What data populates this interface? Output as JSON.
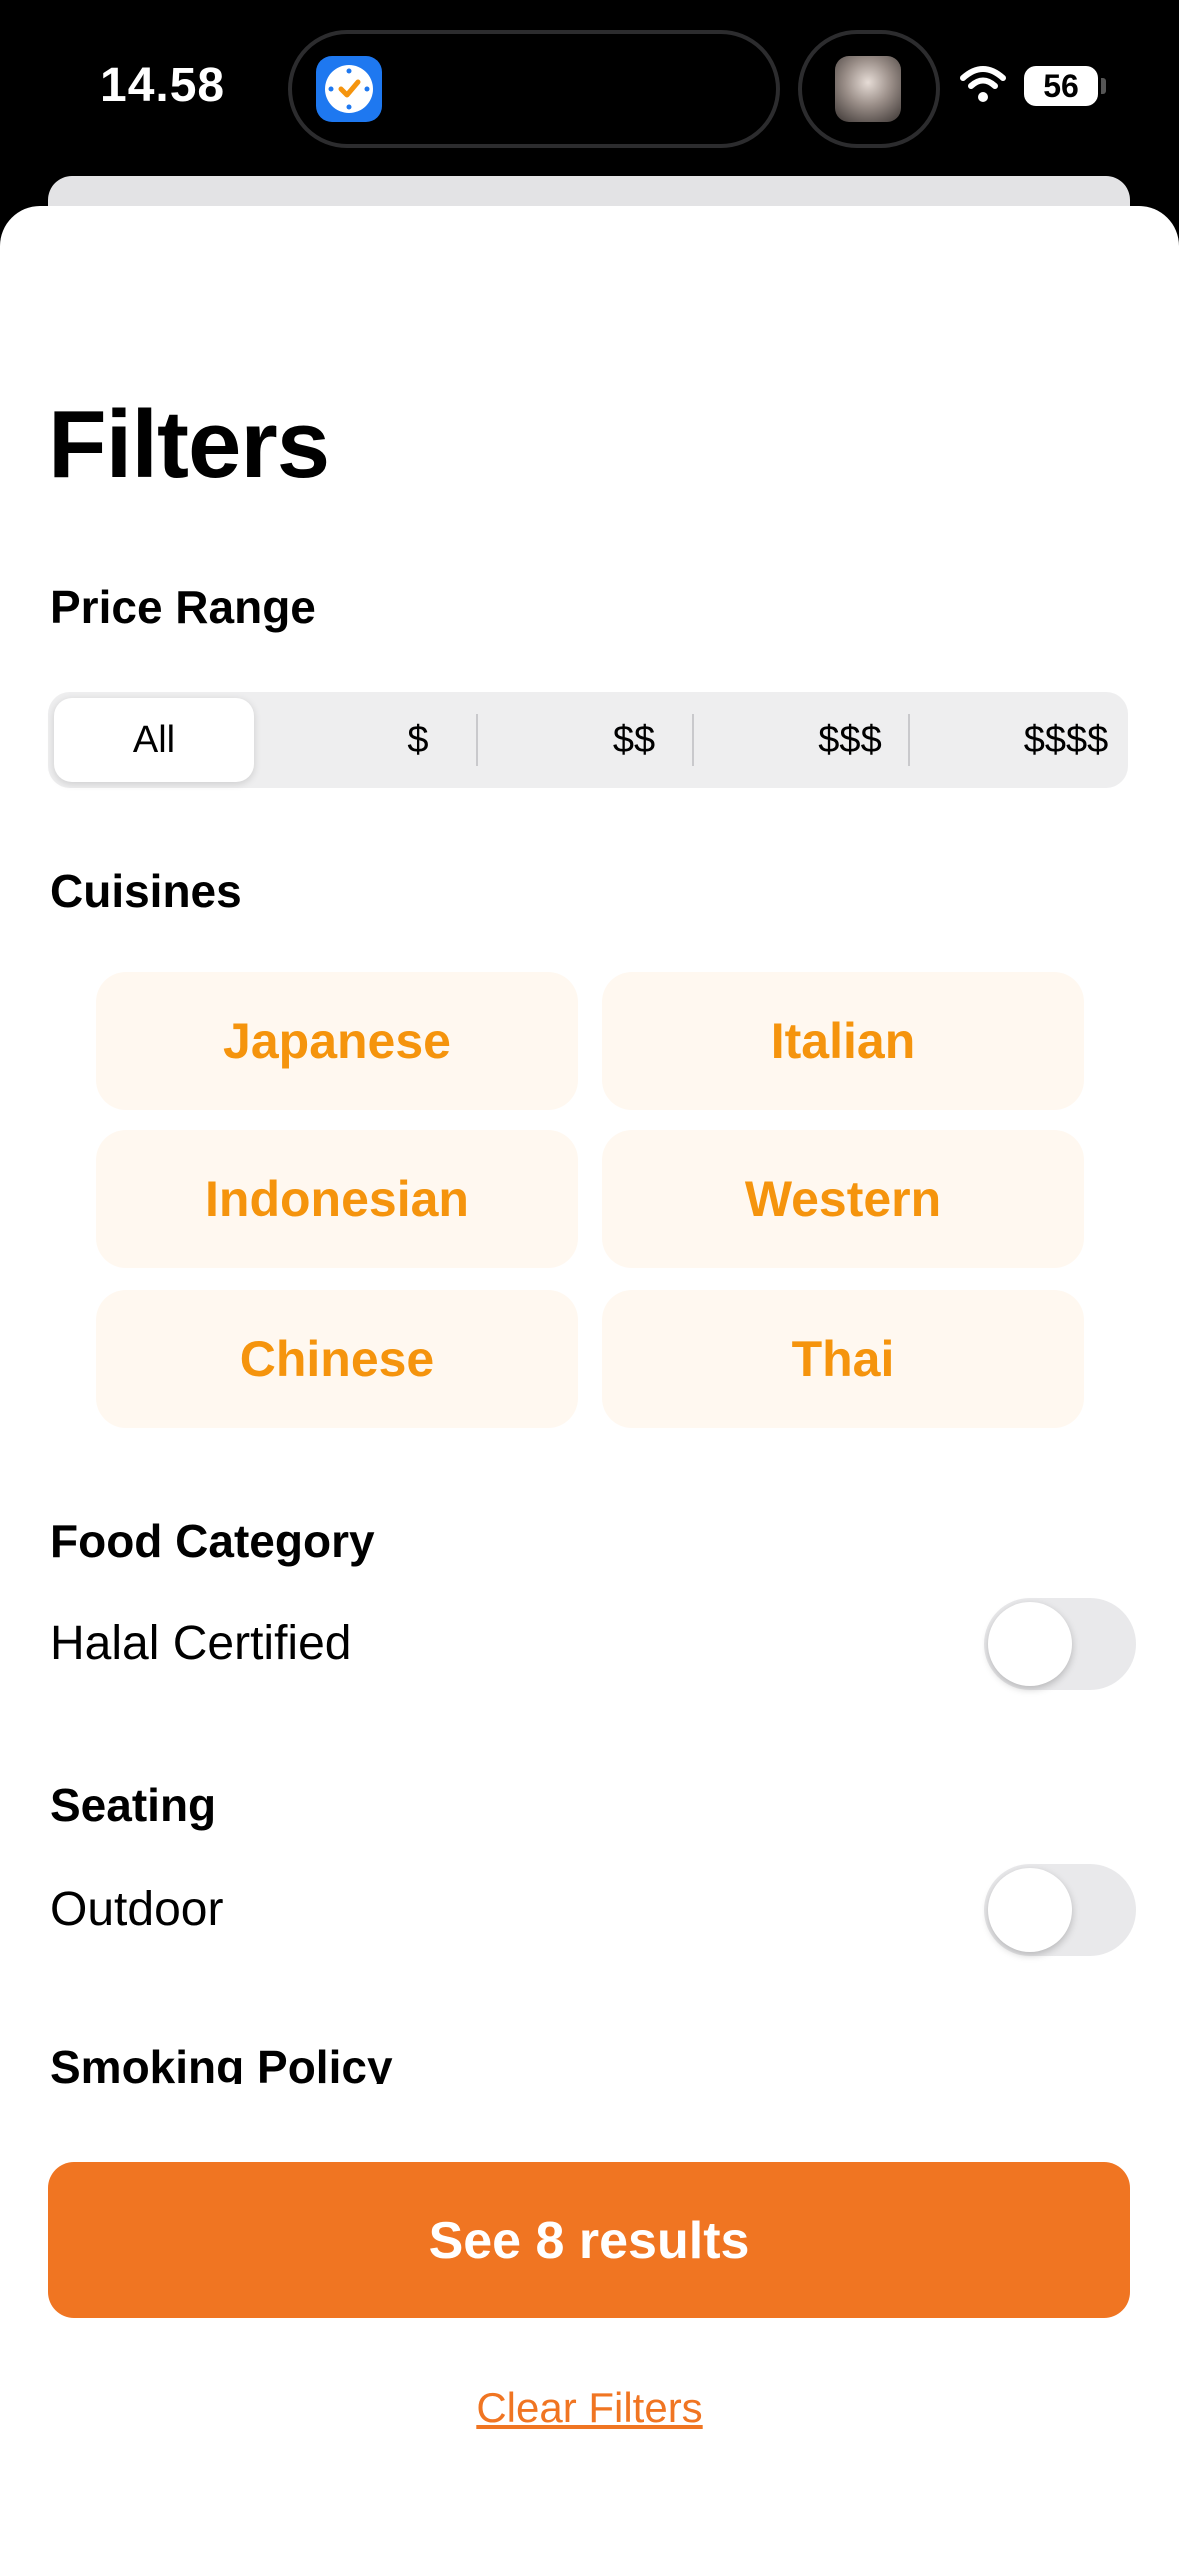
{
  "status_bar": {
    "time": "14.58",
    "battery": "56"
  },
  "page": {
    "title": "Filters"
  },
  "price_range": {
    "heading": "Price Range",
    "options": [
      "All",
      "$",
      "$$",
      "$$$",
      "$$$$"
    ],
    "selected": "All"
  },
  "cuisines": {
    "heading": "Cuisines",
    "items": [
      "Japanese",
      "Italian",
      "Indonesian",
      "Western",
      "Chinese",
      "Thai"
    ]
  },
  "food_category": {
    "heading": "Food Category",
    "toggle_label": "Halal Certified",
    "on": false
  },
  "seating": {
    "heading": "Seating",
    "toggle_label": "Outdoor",
    "on": false
  },
  "smoking_policy": {
    "heading": "Smoking Policy"
  },
  "actions": {
    "results_label": "See 8 results",
    "clear_label": "Clear Filters"
  },
  "colors": {
    "accent": "#f07522",
    "chip_text": "#f5940d",
    "chip_bg": "#fff8f0"
  }
}
